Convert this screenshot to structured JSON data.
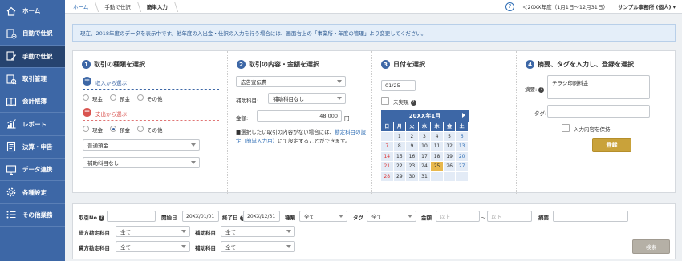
{
  "sidebar": {
    "items": [
      {
        "label": "ホーム",
        "icon": "home-icon"
      },
      {
        "label": "自動で仕訳",
        "icon": "auto-journal-icon"
      },
      {
        "label": "手動で仕訳",
        "icon": "manual-journal-icon"
      },
      {
        "label": "取引管理",
        "icon": "transaction-icon"
      },
      {
        "label": "会計帳簿",
        "icon": "ledger-icon"
      },
      {
        "label": "レポート",
        "icon": "report-icon"
      },
      {
        "label": "決算・申告",
        "icon": "settlement-icon"
      },
      {
        "label": "データ連携",
        "icon": "data-link-icon"
      },
      {
        "label": "各種設定",
        "icon": "settings-icon"
      },
      {
        "label": "その他業務",
        "icon": "other-tasks-icon"
      }
    ],
    "active_index": 2
  },
  "topbar": {
    "breadcrumb": [
      "ホーム",
      "手動で仕訳",
      "簡単入力"
    ],
    "help": "?",
    "year_selector": "＜20XX年度（1月1日〜12月31日）",
    "office": "サンプル事務所 (個人) ▾"
  },
  "notice": "現在、2018年度のデータを表示中です。他年度の入出金・仕訳の入力を行う場合には、画面右上の「事業所・年度の管理」より変更してください。",
  "step1": {
    "num": "1",
    "title": "取引の種類を選択",
    "income_label": "収入から選ぶ",
    "expense_label": "支出から選ぶ",
    "income_options": [
      "現金",
      "預金",
      "その他"
    ],
    "expense_options": [
      "現金",
      "預金",
      "その他"
    ],
    "account_select": "普通預金",
    "sub_account_select": "補助科目なし"
  },
  "step2": {
    "num": "2",
    "title": "取引の内容・金額を選択",
    "content_select": "広告宣伝費",
    "sub_label": "補助科目:",
    "sub_select": "補助科目なし",
    "amount_label": "金額:",
    "amount_value": "48,000",
    "amount_unit": "円",
    "note_1": "■選択したい取引の内容がない場合には、",
    "note_link": "勘定科目の設定（簡単入力用）",
    "note_2": "にて設定することができます。"
  },
  "step3": {
    "num": "3",
    "title": "日付を選択",
    "date_value": "01/25",
    "unrealized_label": "未実現",
    "calendar": {
      "month_label": "20XX年1月",
      "weekdays": [
        "日",
        "月",
        "火",
        "水",
        "木",
        "金",
        "土"
      ],
      "weeks": [
        [
          "",
          "1",
          "2",
          "3",
          "4",
          "5",
          "6"
        ],
        [
          "7",
          "8",
          "9",
          "10",
          "11",
          "12",
          "13"
        ],
        [
          "14",
          "15",
          "16",
          "17",
          "18",
          "19",
          "20"
        ],
        [
          "21",
          "22",
          "23",
          "24",
          "25",
          "26",
          "27"
        ],
        [
          "28",
          "29",
          "30",
          "31",
          "",
          "",
          ""
        ]
      ],
      "selected_day": "25"
    }
  },
  "step4": {
    "num": "4",
    "title": "摘要、タグを入力し、登録を選択",
    "memo_label": "摘要:",
    "memo_value": "チラシ印刷料金",
    "tag_label": "タグ:",
    "tag_value": "",
    "keep_label": "入力内容を保持",
    "register_button": "登録"
  },
  "filter": {
    "txn_no_label": "取引No",
    "start_label": "開始日",
    "start_value": "20XX/01/01",
    "end_label": "終了日",
    "end_value": "20XX/12/31",
    "type_label": "種類",
    "type_value": "全て",
    "tag_label": "タグ",
    "tag_value": "全て",
    "amount_label": "金額",
    "amount_min_placeholder": "以上",
    "amount_sep": "〜",
    "amount_max_placeholder": "以下",
    "memo_label": "摘要",
    "debit_label": "借方勘定科目",
    "debit_value": "全て",
    "debit_sub_label": "補助科目",
    "debit_sub_value": "全て",
    "credit_label": "貸方勘定科目",
    "credit_value": "全て",
    "credit_sub_label": "補助科目",
    "credit_sub_value": "全て",
    "search_button": "検索"
  },
  "colors": {
    "sidebar": "#3d67a6",
    "sidebar_active": "#26436f",
    "accent": "#3d67a6",
    "gold": "#c9a23a",
    "expense_red": "#d9534f"
  }
}
